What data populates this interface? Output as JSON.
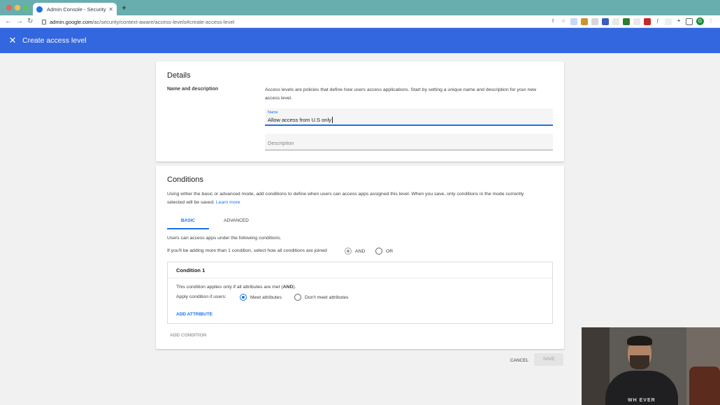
{
  "browser": {
    "tab_title": "Admin Console - Security - Co",
    "new_tab_glyph": "+",
    "url_host": "admin.google.com",
    "url_path": "/ac/security/context-aware/access-levels#create-access-level",
    "profile_initial": "G",
    "extension_icons": [
      "share-icon",
      "star-icon",
      "extension-icon",
      "extension-icon",
      "extension-icon",
      "extension-icon",
      "extension-icon",
      "extension-icon",
      "extension-icon",
      "extension-icon",
      "extension-icon",
      "puzzle-icon",
      "sidebar-icon"
    ]
  },
  "header": {
    "close_glyph": "✕",
    "title": "Create access level",
    "color": "#3367e0"
  },
  "details": {
    "title": "Details",
    "section_label": "Name and description",
    "intro_line1": "Access levels are policies that define how users access applications. Start by setting a unique name and description for your new",
    "intro_line2": "access level.",
    "name_label": "Name",
    "name_value": "Allow access from U.S only",
    "description_placeholder": "Description"
  },
  "conditions": {
    "title": "Conditions",
    "intro_line1": "Using either the basic or advanced mode, add conditions to define when users can access apps assigned this level. When you save, only conditions in the mode currently",
    "intro_line2": "selected will be saved.",
    "learn_more": "Learn more",
    "tabs": [
      "BASIC",
      "ADVANCED"
    ],
    "active_tab": "BASIC",
    "users_text": "Users can access apps under the following conditions.",
    "join_prompt": "If you'll be adding more than 1 condition, select how all conditions are joined",
    "join_options": [
      "AND",
      "OR"
    ],
    "join_selected": "AND",
    "condition": {
      "title": "Condition 1",
      "note_prefix": "This condition applies only if all attributes are met (",
      "note_bold": "AND",
      "note_suffix": ").",
      "apply_label": "Apply condition if users:",
      "apply_options": [
        "Meet attributes",
        "Don't meet attributes"
      ],
      "apply_selected": "Meet attributes",
      "add_attribute": "ADD ATTRIBUTE"
    },
    "add_condition": "ADD CONDITION"
  },
  "footer": {
    "cancel": "CANCEL",
    "save": "SAVE"
  },
  "webcam": {
    "shirt_text": "WH    EVER"
  },
  "colors": {
    "accent": "#1a73e8",
    "page_bg": "#f1f1f1",
    "tabstrip": "#69aeae"
  }
}
